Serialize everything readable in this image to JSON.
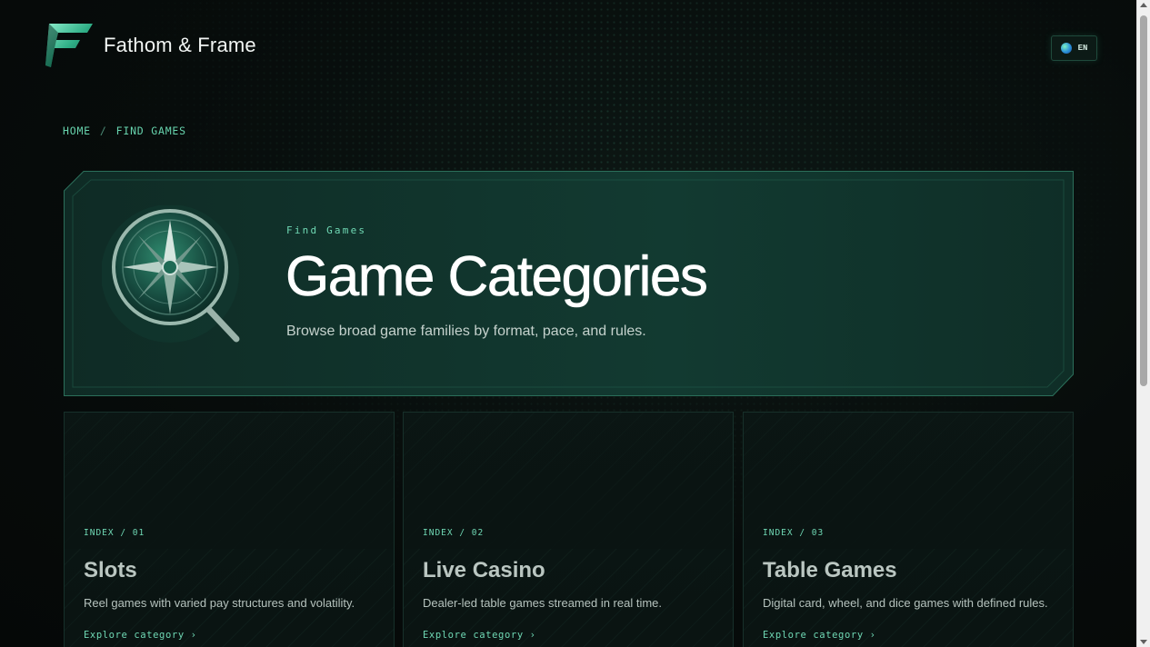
{
  "header": {
    "brand": "Fathom & Frame",
    "logo_icon": "fathom-frame-f-logo",
    "language": "EN",
    "language_icon": "globe-icon"
  },
  "breadcrumb": {
    "home": "HOME",
    "separator": "/",
    "current": "FIND GAMES"
  },
  "hero": {
    "eyebrow": "Find Games",
    "title": "Game Categories",
    "subtitle": "Browse broad game families by format, pace, and rules.",
    "illustration_icon": "compass-magnifier-icon"
  },
  "categories": [
    {
      "index": "INDEX / 01",
      "name": "Slots",
      "description": "Reel games with varied pay structures and volatility.",
      "link": "Explore category ›"
    },
    {
      "index": "INDEX / 02",
      "name": "Live Casino",
      "description": "Dealer-led table games streamed in real time.",
      "link": "Explore category ›"
    },
    {
      "index": "INDEX / 03",
      "name": "Table Games",
      "description": "Digital card, wheel, and dice games with defined rules.",
      "link": "Explore category ›"
    }
  ],
  "colors": {
    "accent": "#6fd8b4",
    "background": "#060a09",
    "panel": "#0f2a24"
  }
}
